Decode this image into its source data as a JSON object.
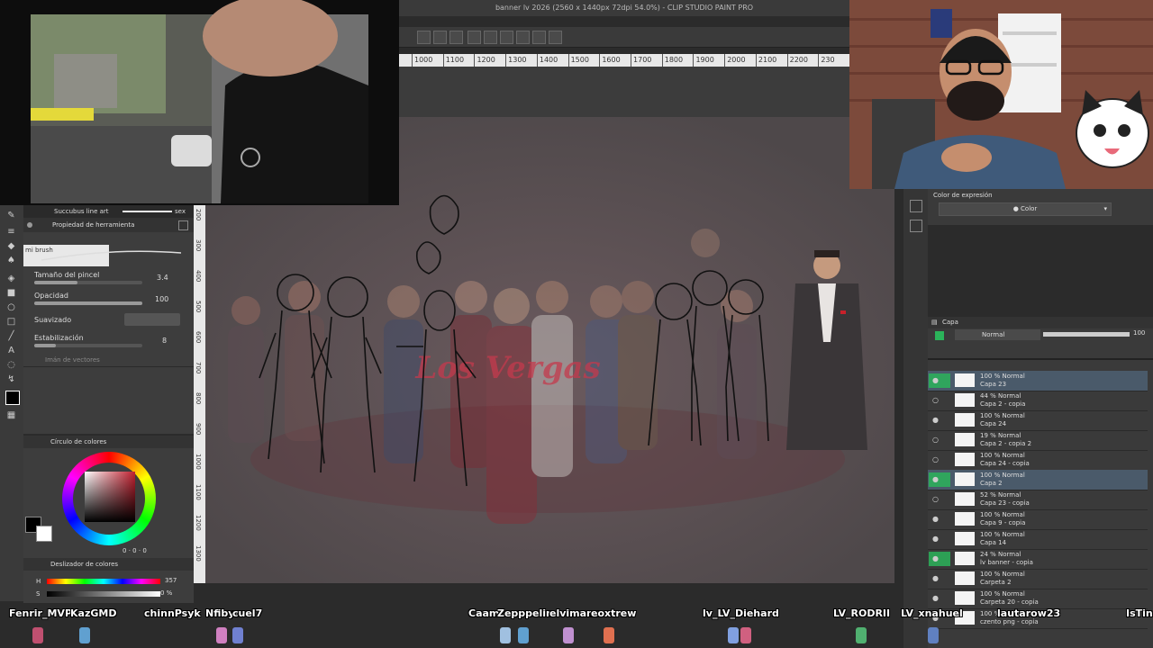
{
  "app": {
    "title": "banner lv 2026 (2560 x 1440px 72dpi 54.0%) - CLIP STUDIO PAINT PRO"
  },
  "ruler": {
    "ticks": [
      "1000",
      "1100",
      "1200",
      "1300",
      "1400",
      "1500",
      "1600",
      "1700",
      "1800",
      "1900",
      "2000",
      "2100",
      "2200",
      "230"
    ]
  },
  "vruler": {
    "ticks": [
      "200",
      "300",
      "400",
      "500",
      "600",
      "700",
      "800",
      "900",
      "1000",
      "1100",
      "1200",
      "1300"
    ]
  },
  "brush_strip": {
    "brush_name": "Succubus line art",
    "sex_label": "sex"
  },
  "tool_property": {
    "panel_title": "Propiedad de herramienta",
    "brush_label": "mi brush",
    "brush_size_label": "Tamaño del pincel",
    "brush_size_value": "3.4",
    "opacity_label": "Opacidad",
    "opacity_value": "100",
    "smoothing_label": "Suavizado",
    "stabilization_label": "Estabilización",
    "stabilization_value": "8",
    "vector_magnet_label": "Imán de vectores"
  },
  "color_wheel": {
    "panel_title": "Círculo de colores",
    "values": [
      "0",
      "0",
      "0"
    ]
  },
  "color_slider": {
    "panel_title": "Deslizador de colores",
    "h_label": "H",
    "h_value": "357",
    "s_label": "S",
    "s_value": "0 %"
  },
  "expression": {
    "label": "Color de expresión",
    "value": "Color"
  },
  "layer_panel": {
    "tab": "Capa",
    "blend_mode": "Normal",
    "opacity": "100",
    "layers": [
      {
        "pct": "100 % Normal",
        "name": "Capa 23",
        "selected": true,
        "green": true,
        "eye": true
      },
      {
        "pct": "44 % Normal",
        "name": "Capa 2 - copia",
        "selected": false,
        "green": false,
        "eye": false
      },
      {
        "pct": "100 % Normal",
        "name": "Capa 24",
        "selected": false,
        "green": false,
        "eye": true
      },
      {
        "pct": "19 % Normal",
        "name": "Capa 2 - copia 2",
        "selected": false,
        "green": false,
        "eye": false
      },
      {
        "pct": "100 % Normal",
        "name": "Capa 24 - copia",
        "selected": false,
        "green": false,
        "eye": false
      },
      {
        "pct": "100 % Normal",
        "name": "Capa 2",
        "selected": true,
        "green": true,
        "eye": true
      },
      {
        "pct": "52 % Normal",
        "name": "Capa 23 - copia",
        "selected": false,
        "green": false,
        "eye": false
      },
      {
        "pct": "100 % Normal",
        "name": "Capa 9 - copia",
        "selected": false,
        "green": false,
        "eye": true
      },
      {
        "pct": "100 % Normal",
        "name": "Capa 14",
        "selected": false,
        "green": false,
        "eye": true
      },
      {
        "pct": "24 % Normal",
        "name": "lv banner - copia",
        "selected": false,
        "green": true,
        "eye": true
      },
      {
        "pct": "100 % Normal",
        "name": "Carpeta 2",
        "selected": false,
        "green": false,
        "eye": true
      },
      {
        "pct": "100 % Normal",
        "name": "Carpeta 20 - copia",
        "selected": false,
        "green": false,
        "eye": true
      },
      {
        "pct": "100 % Normal",
        "name": "czento png - copia",
        "selected": false,
        "green": false,
        "eye": true
      }
    ]
  },
  "canvas": {
    "logo_text": "Los Vergas"
  },
  "chat": {
    "names": [
      "Fenrir_MVP",
      "KazGMD",
      "chinnPsyk",
      "Nfibyr",
      "cuel7",
      "Caam",
      "Zepppelin",
      "elvimanc",
      "eoxtrew",
      "lv_LV_Diehard",
      "LV_RODRII",
      "LV_xnahuel",
      "lautarow23",
      "IsTin"
    ]
  }
}
